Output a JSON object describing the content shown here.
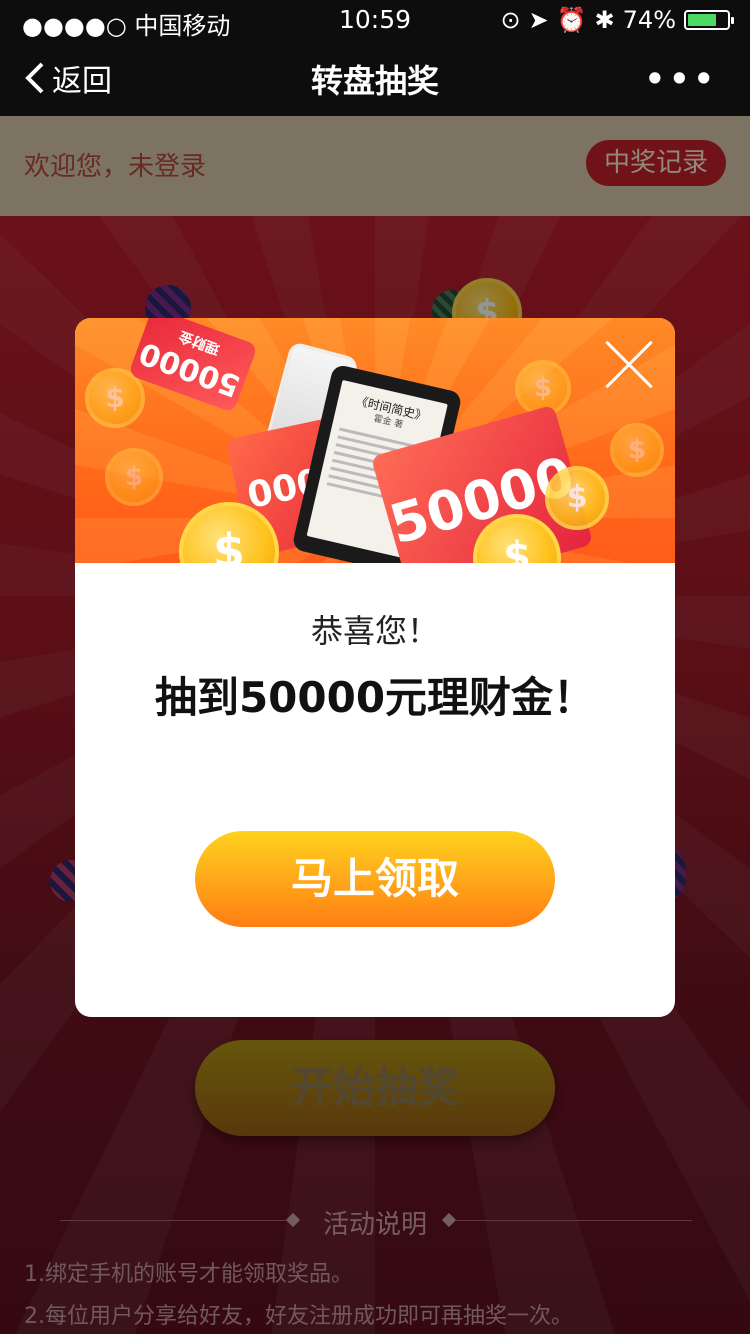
{
  "status_bar": {
    "carrier": "●●●●○ 中国移动",
    "time": "10:59",
    "battery": "74%",
    "battery_level": 0.74
  },
  "nav": {
    "back_label": "返回",
    "title": "转盘抽奖",
    "more": "•••"
  },
  "header": {
    "welcome": "欢迎您，未登录",
    "record_button": "中奖记录"
  },
  "main": {
    "start_button": "开始抽奖",
    "rules_title": "活动说明",
    "rules": [
      "1.绑定手机的账号才能领取奖品。",
      "2.每位用户分享给好友，好友注册成功即可再抽奖一次。"
    ]
  },
  "modal": {
    "banner": {
      "card_top_value": "50000",
      "card_top_sub": "理财金",
      "card_mid_value": "0000",
      "card_big_value": "50000",
      "book_title": "《时间简史》",
      "book_sub": "霍金 著",
      "coin_symbol": "$"
    },
    "congrats": "恭喜您！",
    "prize_text": "抽到50000元理财金！",
    "claim_button": "马上领取"
  },
  "colors": {
    "accent_red": "#c1212c",
    "banner_orange": "#ff6a1a",
    "button_gold": "#ffa41a"
  }
}
